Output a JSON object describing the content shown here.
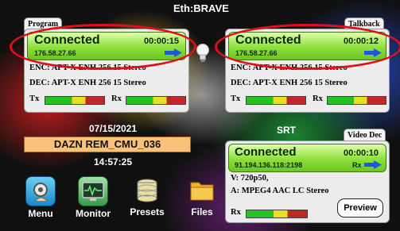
{
  "header": {
    "title": "Eth:BRAVE"
  },
  "program": {
    "tab_label": "Program",
    "status": "Connected",
    "timer": "00:00:15",
    "ip": "176.58.27.66",
    "enc": "ENC: APT-X ENH 256 15 Stereo",
    "dec": "DEC: APT-X ENH 256 15 Stereo",
    "tx_label": "Tx",
    "rx_label": "Rx"
  },
  "talkback": {
    "tab_label": "Talkback",
    "status": "Connected",
    "timer": "00:00:12",
    "ip": "176.58.27.66",
    "enc": "ENC: APT-X ENH 256 15 Stereo",
    "dec": "DEC: APT-X ENH 256 15 Stereo",
    "tx_label": "Tx",
    "rx_label": "Rx"
  },
  "info": {
    "date": "07/15/2021",
    "device_name": "DAZN REM_CMU_036",
    "time": "14:57:25"
  },
  "srt": {
    "section_label": "SRT",
    "tab_label": "Video Dec",
    "status": "Connected",
    "timer": "00:00:10",
    "address": "91.194.136.118:2198",
    "direction": "Rx",
    "video": "V: 720p50,",
    "audio": "A: MPEG4 AAC LC Stereo",
    "rx_label": "Rx",
    "preview_label": "Preview"
  },
  "toolbar": {
    "menu_label": "Menu",
    "monitor_label": "Monitor",
    "presets_label": "Presets",
    "files_label": "Files"
  },
  "meters": {
    "program_tx": 0.0,
    "program_rx": 0.0,
    "talkback_tx": 0.0,
    "talkback_rx": 0.0,
    "srt_rx": 0.0
  },
  "icons": {
    "connected_arrow": "arrow-right-icon",
    "bulb": "lightbulb-icon",
    "menu": "gear-hand-icon",
    "monitor": "monitor-waveform-icon",
    "presets": "database-icon",
    "files": "folder-icon"
  },
  "colors": {
    "status_green": "#8fe03a",
    "highlight_red": "#e0101b",
    "device_name_bg": "#f8c27a",
    "arrow_blue": "#1e58d8"
  }
}
